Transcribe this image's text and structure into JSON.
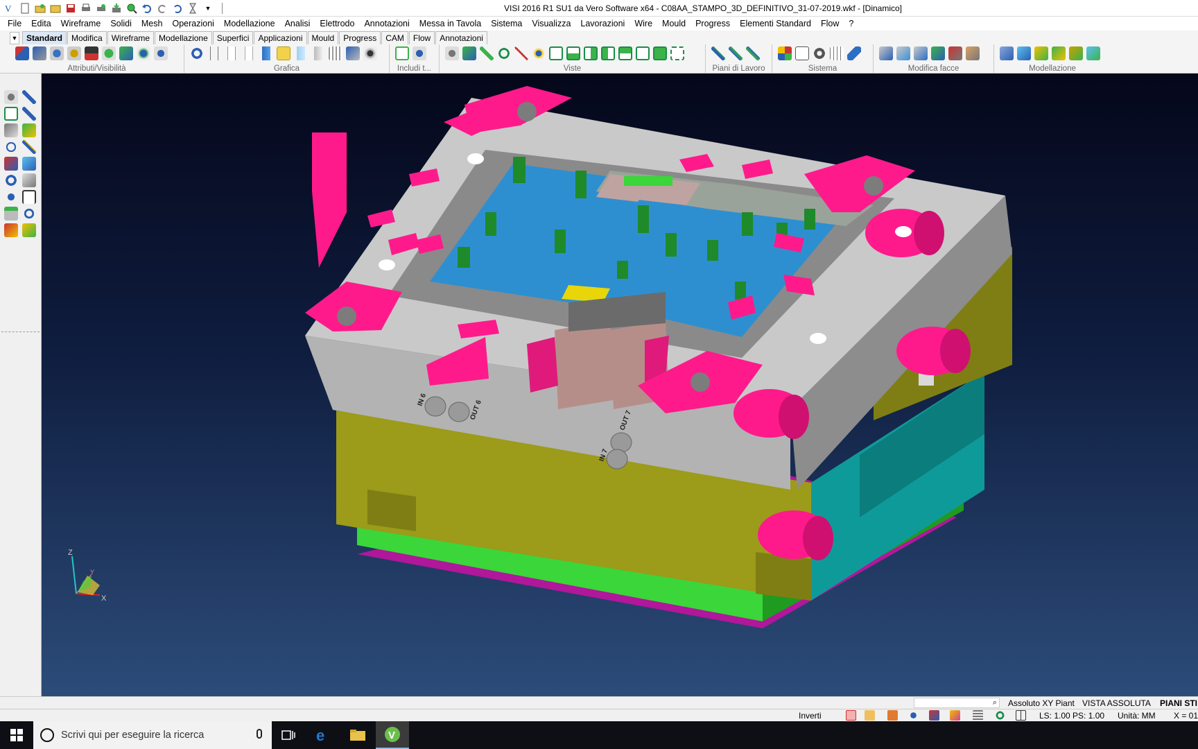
{
  "title": "VISI 2016 R1 SU1 da Vero Software x64 - C08AA_STAMPO_3D_DEFINITIVO_31-07-2019.wkf - [Dinamico]",
  "menu": [
    "File",
    "Edita",
    "Wireframe",
    "Solidi",
    "Mesh",
    "Operazioni",
    "Modellazione",
    "Analisi",
    "Elettrodo",
    "Annotazioni",
    "Messa in Tavola",
    "Sistema",
    "Visualizza",
    "Lavorazioni",
    "Wire",
    "Mould",
    "Progress",
    "Elementi Standard",
    "Flow",
    "?"
  ],
  "ribbon_tabs": [
    "Standard",
    "Modifica",
    "Wireframe",
    "Modellazione",
    "Superfici",
    "Applicazioni",
    "Mould",
    "Progress",
    "CAM",
    "Flow",
    "Annotazioni"
  ],
  "ribbon_groups": [
    "Attributi/Visibilità",
    "Grafica",
    "Includi t...",
    "Viste",
    "Piani di Lavoro",
    "Sistema",
    "Modifica facce",
    "Modellazione"
  ],
  "viewport": {
    "triad": {
      "z": "Z",
      "x": "X",
      "y": "Y"
    },
    "engravings": [
      "IN 6",
      "OUT 6",
      "OUT 7",
      "IN 7"
    ]
  },
  "status": {
    "row1": {
      "absolute": "Assoluto XY Piant",
      "view": "VISTA ASSOLUTA",
      "plans": "PIANI STI"
    },
    "row2": {
      "invert": "Inverti",
      "ls_ps": "LS: 1.00 PS: 1.00",
      "units": "Unità: MM",
      "coord": "X = 01"
    }
  },
  "taskbar": {
    "search_placeholder": "Scrivi qui per eseguire la ricerca"
  },
  "colors": {
    "accent": "#ff1a8c",
    "viewport_top": "#05071a",
    "viewport_bottom": "#2c4c79"
  }
}
